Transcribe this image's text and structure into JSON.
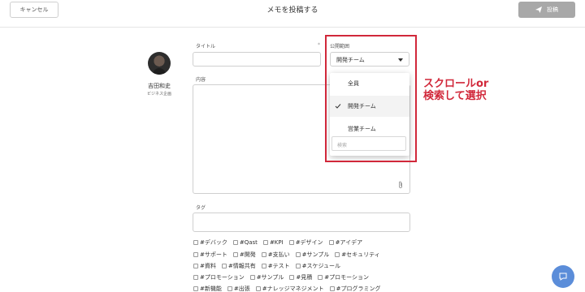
{
  "header": {
    "cancel_label": "キャンセル",
    "title": "メモを投稿する",
    "post_label": "投稿"
  },
  "user": {
    "name": "吉田和史",
    "role": "ビジネス企画"
  },
  "form": {
    "title_label": "タイトル",
    "title_required_mark": "*",
    "title_value": "",
    "content_label": "内容",
    "content_value": "",
    "tag_label": "タグ",
    "tag_value": ""
  },
  "scope": {
    "label": "公開範囲",
    "selected": "開発チーム",
    "options": [
      {
        "label": "全員",
        "selected": false
      },
      {
        "label": "開発チーム",
        "selected": true
      },
      {
        "label": "営業チーム",
        "selected": false
      }
    ],
    "search_placeholder": "検索"
  },
  "annotation": {
    "line1": "スクロールor",
    "line2": "検索して選択",
    "color": "#d1283a"
  },
  "tags": [
    [
      "#デバック",
      "#Qast",
      "#KPI",
      "#デザイン",
      "#アイデア"
    ],
    [
      "#サポート",
      "#開発",
      "#支払い",
      "#サンプル",
      "#セキュリティ"
    ],
    [
      "#資料",
      "#情報共有",
      "#テスト",
      "#スケジュール"
    ],
    [
      "#プロモーション",
      "#サンプル",
      "#見積",
      "#プロモーション"
    ],
    [
      "#新機能",
      "#出張",
      "#ナレッジマネジメント",
      "#プログラミング"
    ]
  ],
  "colors": {
    "post_button": "#a8a8a8",
    "chat_button": "#5b8dd9",
    "highlight": "#d1283a"
  },
  "icons": {
    "post": "paper-plane-icon",
    "attach": "paperclip-icon",
    "check": "checkmark-icon",
    "chat": "chat-bubble-icon"
  }
}
